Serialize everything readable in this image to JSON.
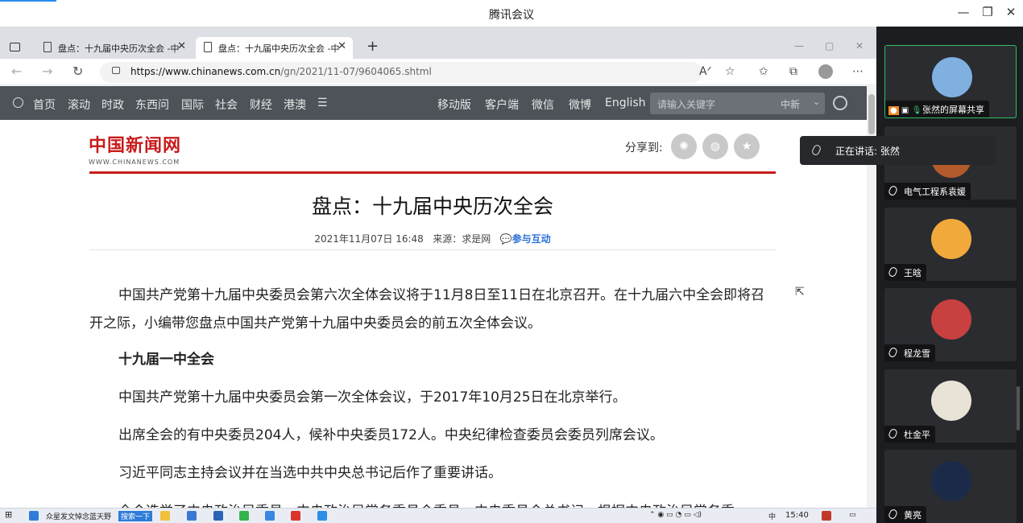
{
  "meeting": {
    "title": "腾讯会议",
    "min_glyph": "—",
    "max_glyph": "❐",
    "close_glyph": "✕"
  },
  "browser": {
    "tabs": [
      {
        "label": "盘点：十九届中央历次全会 -中新",
        "active": false
      },
      {
        "label": "盘点：十九届中央历次全会 -中新",
        "active": true
      }
    ],
    "new_tab_glyph": "+",
    "url_host": "https://www.chinanews.com.cn",
    "url_path": "/gn/2021/11-07/9604065.shtml",
    "back_glyph": "←",
    "forward_glyph": "→",
    "refresh_glyph": "↻"
  },
  "site_nav": {
    "left_items": [
      "首页",
      "滚动",
      "时政",
      "东西问",
      "国际",
      "社会",
      "财经",
      "港澳"
    ],
    "menu_glyph": "☰",
    "right_items": [
      "移动版",
      "客户端",
      "微信",
      "微博",
      "English"
    ],
    "search_placeholder": "请输入关键字",
    "search_scope": "中新"
  },
  "article": {
    "logo_cn": "中国新闻网",
    "logo_en": "WWW.CHINANEWS.COM",
    "share_label": "分享到:",
    "headline": "盘点：十九届中央历次全会",
    "meta_date": "2021年11月07日 16:48",
    "meta_source": "来源：求是网",
    "meta_link": "参与互动",
    "paragraphs": [
      "中国共产党第十九届中央委员会第六次全体会议将于11月8日至11日在北京召开。在十九届六中全会即将召开之际，小编带您盘点中国共产党第十九届中央委员会的前五次全体会议。",
      "十九届一中全会",
      "中国共产党第十九届中央委员会第一次全体会议，于2017年10月25日在北京举行。",
      "出席全会的有中央委员204人，候补中央委员172人。中央纪律检查委员会委员列席会议。",
      "习近平同志主持会议并在当选中共中央总书记后作了重要讲话。",
      "全会选举了中央政治局委员、中央政治局常务委员会委员、中央委员会总书记，根据中央政治局常务委"
    ]
  },
  "taskbar": {
    "item1": "众星发文悼念蓝天野",
    "search_btn": "搜索一下",
    "lang": "中",
    "time": "15:40"
  },
  "participants": [
    {
      "name": "张然的屏幕共享",
      "color": "#7fb0e0",
      "active": true
    },
    {
      "name": "电气工程系袁媛",
      "color": "#b35a2a",
      "active": false
    },
    {
      "name": "王晗",
      "color": "#f2a93b",
      "active": false
    },
    {
      "name": "程龙雪",
      "color": "#c84040",
      "active": false
    },
    {
      "name": "杜金平",
      "color": "#e9e2d6",
      "active": false
    },
    {
      "name": "黄亮",
      "color": "#1c2a4a",
      "active": false
    }
  ],
  "speaking": {
    "text": "正在讲话: 张然"
  }
}
